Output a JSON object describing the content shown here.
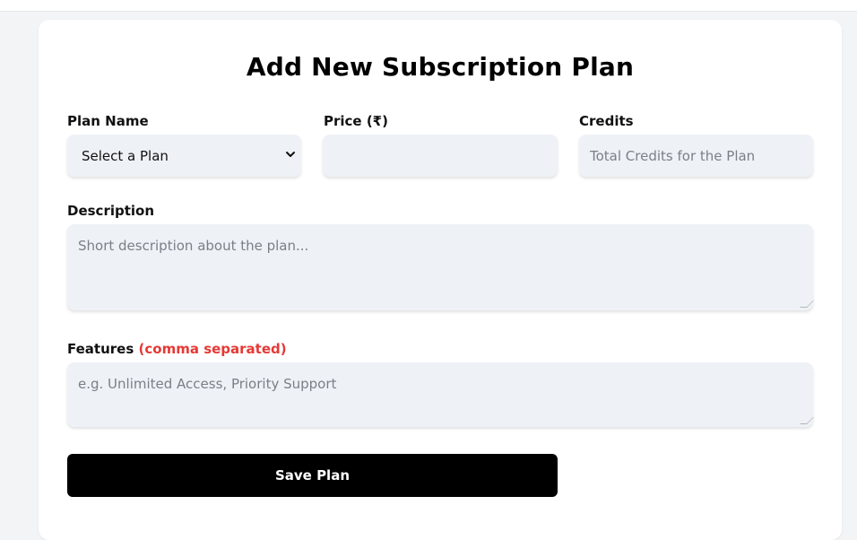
{
  "form": {
    "title": "Add New Subscription Plan",
    "plan_name": {
      "label": "Plan Name",
      "selected": "Select a Plan"
    },
    "price": {
      "label": "Price (₹)",
      "value": "",
      "placeholder": ""
    },
    "credits": {
      "label": "Credits",
      "value": "",
      "placeholder": "Total Credits for the Plan"
    },
    "description": {
      "label": "Description",
      "value": "",
      "placeholder": "Short description about the plan..."
    },
    "features": {
      "label": "Features",
      "note": "(comma separated)",
      "value": "",
      "placeholder": "e.g. Unlimited Access, Priority Support"
    },
    "save_label": "Save Plan"
  },
  "icons": {
    "select_chevron": "chevron-down-icon"
  },
  "colors": {
    "button_bg": "#000000",
    "field_bg": "#eef2f7",
    "note_red": "#e53935"
  }
}
